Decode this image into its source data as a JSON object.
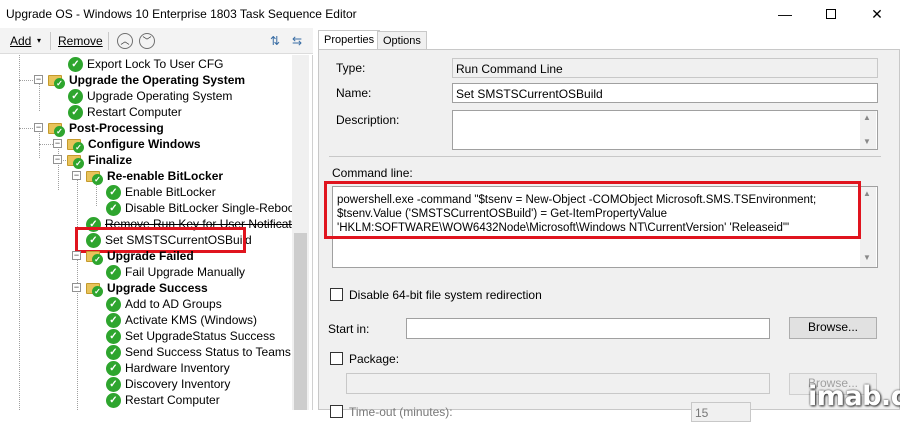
{
  "window": {
    "title": "Upgrade OS - Windows 10 Enterprise 1803 Task Sequence Editor",
    "minimize_glyph": "—",
    "close_glyph": "✕"
  },
  "toolbar": {
    "add_label": "Add",
    "add_caret": "▾",
    "remove_label": "Remove",
    "move_up_glyph": "︿",
    "move_down_glyph": "﹀",
    "icon_a": "⇅",
    "icon_b": "⇆"
  },
  "tree": {
    "export_lock": "Export Lock To User CFG",
    "upgrade_os_group": "Upgrade the Operating System",
    "upgrade_os_step": "Upgrade Operating System",
    "restart_1": "Restart Computer",
    "post_processing": "Post-Processing",
    "configure_windows": "Configure Windows",
    "finalize": "Finalize",
    "reenable_bitlocker": "Re-enable BitLocker",
    "enable_bitlocker": "Enable BitLocker",
    "disable_bitlocker": "Disable BitLocker Single-Reboot",
    "remove_run_key": "Remove Run Key for User Notification",
    "set_smsts": "Set SMSTSCurrentOSBuild",
    "upgrade_failed": "Upgrade Failed",
    "fail_upgrade": "Fail Upgrade Manually",
    "upgrade_success": "Upgrade Success",
    "add_ad_groups": "Add to AD Groups",
    "activate_kms": "Activate KMS (Windows)",
    "set_upgrade_status": "Set UpgradeStatus Success",
    "send_success": "Send Success Status to Teams",
    "hardware_inv": "Hardware Inventory",
    "discovery_inv": "Discovery Inventory",
    "restart_2": "Restart Computer",
    "check_glyph": "✓",
    "expand_glyph": "−"
  },
  "tabs": {
    "properties": "Properties",
    "options": "Options"
  },
  "properties": {
    "type_label": "Type:",
    "type_value": "Run Command Line",
    "name_label": "Name:",
    "name_value": "Set SMSTSCurrentOSBuild",
    "description_label": "Description:",
    "description_value": "",
    "command_line_label": "Command line:",
    "command_line_value": "powershell.exe -command \"$tsenv = New-Object -COMObject Microsoft.SMS.TSEnvironment; $tsenv.Value ('SMSTSCurrentOSBuild') = Get-ItemPropertyValue 'HKLM:SOFTWARE\\WOW6432Node\\Microsoft\\Windows NT\\CurrentVersion' 'Releaseid'\"",
    "disable_64bit_label": "Disable 64-bit file system redirection",
    "start_in_label": "Start in:",
    "start_in_value": "",
    "browse_label": "Browse...",
    "package_label": "Package:",
    "package_value": "",
    "browse_disabled_label": "Browse...",
    "timeout_label": "Time-out (minutes):",
    "timeout_value": "15",
    "scroll_up": "▲",
    "scroll_down": "▼"
  },
  "watermark": "imab.dk",
  "colors": {
    "highlight_box": "#e0141e",
    "success_check": "#2ea52e",
    "folder": "#e8c35a"
  }
}
